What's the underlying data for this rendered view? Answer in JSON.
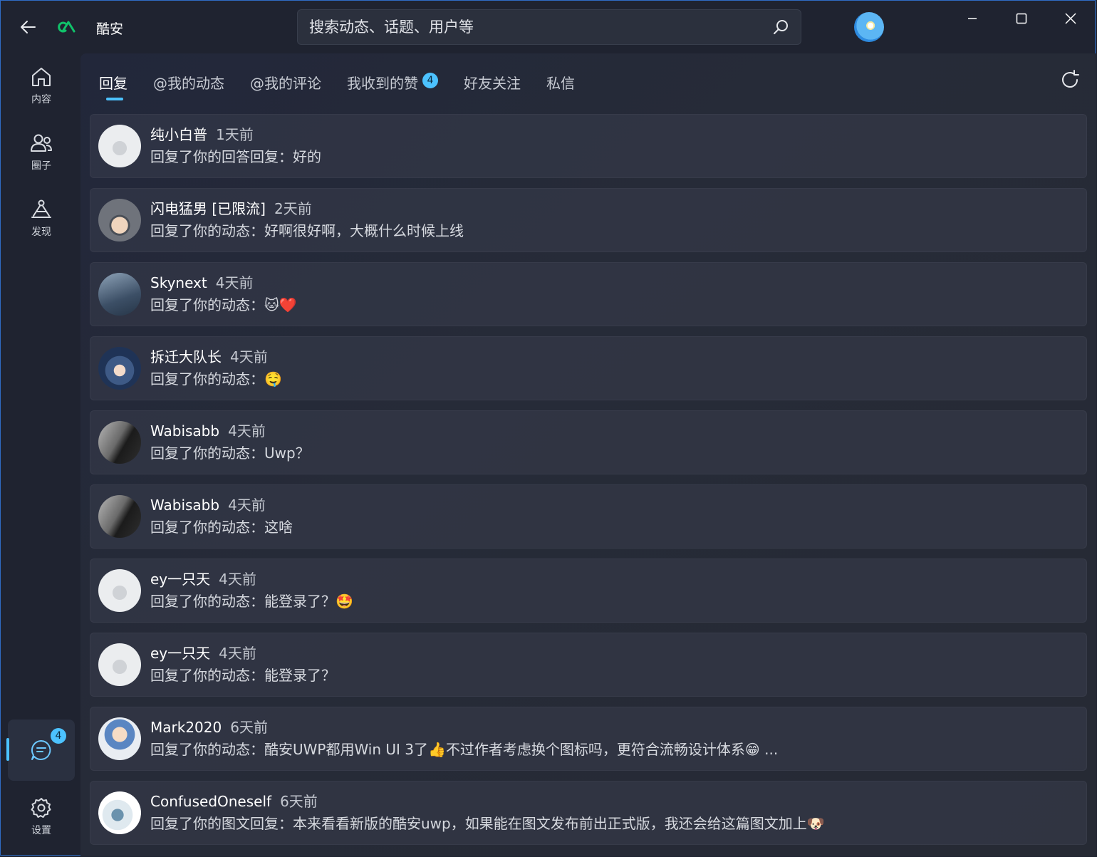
{
  "app": {
    "title": "酷安"
  },
  "search": {
    "placeholder": "搜索动态、话题、用户等"
  },
  "nav": {
    "items": [
      {
        "label": "内容",
        "icon": "home-icon"
      },
      {
        "label": "圈子",
        "icon": "people-icon"
      },
      {
        "label": "发现",
        "icon": "discover-icon"
      }
    ],
    "messages_badge": "4",
    "settings_label": "设置"
  },
  "tabs": [
    {
      "label": "回复",
      "active": true
    },
    {
      "label": "@我的动态"
    },
    {
      "label": "@我的评论"
    },
    {
      "label": "我收到的赞",
      "badge": "4"
    },
    {
      "label": "好友关注"
    },
    {
      "label": "私信"
    }
  ],
  "notifications": [
    {
      "user": "纯小白普",
      "time": "1天前",
      "message": "回复了你的回答回复：好的",
      "avatar": "default"
    },
    {
      "user": "闪电猛男 [已限流]",
      "time": "2天前",
      "message": "回复了你的动态：好啊很好啊，大概什么时候上线",
      "avatar": "graduate"
    },
    {
      "user": "Skynext",
      "time": "4天前",
      "message": "回复了你的动态：",
      "emoji": "🐱❤️",
      "avatar": "sky"
    },
    {
      "user": "拆迁大队长",
      "time": "4天前",
      "message": "回复了你的动态：",
      "emoji": "🤤",
      "avatar": "anime"
    },
    {
      "user": "Wabisabb",
      "time": "4天前",
      "message": "回复了你的动态：Uwp？",
      "avatar": "dark"
    },
    {
      "user": "Wabisabb",
      "time": "4天前",
      "message": "回复了你的动态：这啥",
      "avatar": "dark"
    },
    {
      "user": "ey一只天",
      "time": "4天前",
      "message": "回复了你的动态：能登录了？",
      "emoji": "🤩",
      "avatar": "default"
    },
    {
      "user": "ey一只天",
      "time": "4天前",
      "message": "回复了你的动态：能登录了？",
      "avatar": "default"
    },
    {
      "user": "Mark2020",
      "time": "6天前",
      "message": "回复了你的动态：酷安UWP都用Win UI 3了👍不过作者考虑换个图标吗，更符合流畅设计体系😁 ...",
      "avatar": "cartoon"
    },
    {
      "user": "ConfusedOneself",
      "time": "6天前",
      "message": "回复了你的图文回复：本来看看新版的酷安uwp，如果能在图文发布前出正式版，我还会给这篇图文加上",
      "emoji": "🐶",
      "avatar": "chair"
    }
  ],
  "colors": {
    "accent": "#4cc2ff",
    "brand": "#10c26a",
    "background": "#1f2330"
  }
}
